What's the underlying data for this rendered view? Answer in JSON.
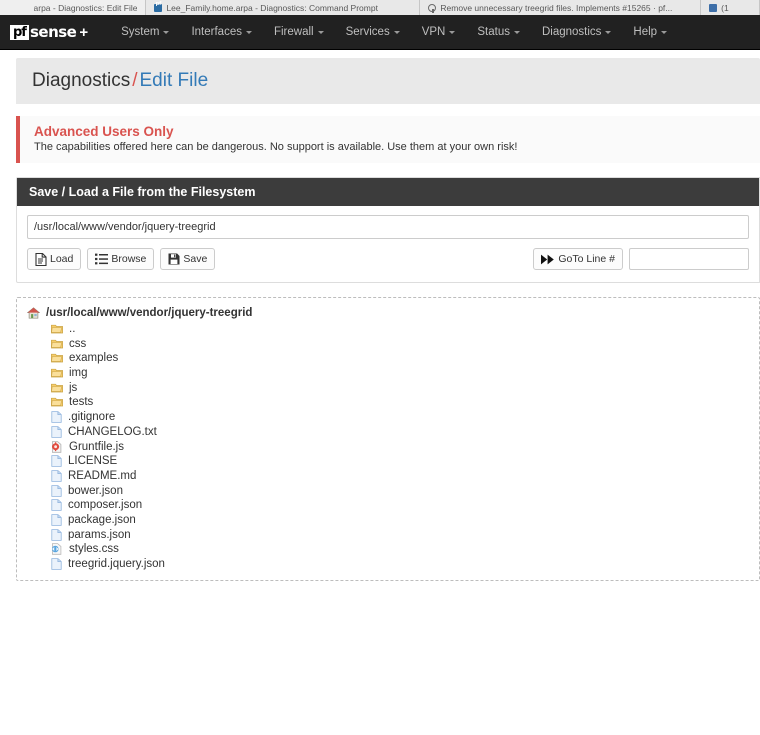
{
  "browser": {
    "tabs": [
      {
        "title": "arpa - Diagnostics: Edit File",
        "favicon": "pfsense-favicon",
        "truncated_left": true
      },
      {
        "title": "Lee_Family.home.arpa - Diagnostics: Command Prompt",
        "favicon": "pfsense-favicon"
      },
      {
        "title": "Remove unnecessary treegrid files. Implements #15265 · pf...",
        "favicon": "github-favicon"
      },
      {
        "title": "(1",
        "favicon": "chart-favicon"
      }
    ]
  },
  "navbar": {
    "brand": {
      "logo": "pf",
      "name": "sense",
      "suffix": "+"
    },
    "items": [
      {
        "label": "System",
        "caret": true
      },
      {
        "label": "Interfaces",
        "caret": true
      },
      {
        "label": "Firewall",
        "caret": true
      },
      {
        "label": "Services",
        "caret": true
      },
      {
        "label": "VPN",
        "caret": true
      },
      {
        "label": "Status",
        "caret": true
      },
      {
        "label": "Diagnostics",
        "caret": true
      },
      {
        "label": "Help",
        "caret": true
      }
    ]
  },
  "breadcrumb": {
    "section": "Diagnostics",
    "separator": "/",
    "page": "Edit File"
  },
  "alert": {
    "title": "Advanced Users Only",
    "body": "The capabilities offered here can be dangerous. No support is available. Use them at your own risk!"
  },
  "panel": {
    "heading": "Save / Load a File from the Filesystem",
    "path_value": "/usr/local/www/vendor/jquery-treegrid",
    "path_placeholder": "",
    "buttons": {
      "load": "Load",
      "browse": "Browse",
      "save": "Save",
      "goto_line": "GoTo Line #"
    },
    "line_value": "",
    "line_placeholder": ""
  },
  "filebrowser": {
    "root": {
      "name": "/usr/local/www/vendor/jquery-treegrid",
      "icon": "home-icon"
    },
    "entries": [
      {
        "name": "..",
        "icon": "folder-icon",
        "type": "folder"
      },
      {
        "name": "css",
        "icon": "folder-icon",
        "type": "folder"
      },
      {
        "name": "examples",
        "icon": "folder-icon",
        "type": "folder"
      },
      {
        "name": "img",
        "icon": "folder-icon",
        "type": "folder"
      },
      {
        "name": "js",
        "icon": "folder-icon",
        "type": "folder"
      },
      {
        "name": "tests",
        "icon": "folder-icon",
        "type": "folder"
      },
      {
        "name": ".gitignore",
        "icon": "file-icon",
        "type": "file"
      },
      {
        "name": "CHANGELOG.txt",
        "icon": "file-icon",
        "type": "file"
      },
      {
        "name": "Gruntfile.js",
        "icon": "script-file-icon",
        "type": "file"
      },
      {
        "name": "LICENSE",
        "icon": "file-icon",
        "type": "file"
      },
      {
        "name": "README.md",
        "icon": "file-icon",
        "type": "file"
      },
      {
        "name": "bower.json",
        "icon": "file-icon",
        "type": "file"
      },
      {
        "name": "composer.json",
        "icon": "file-icon",
        "type": "file"
      },
      {
        "name": "package.json",
        "icon": "file-icon",
        "type": "file"
      },
      {
        "name": "params.json",
        "icon": "file-icon",
        "type": "file"
      },
      {
        "name": "styles.css",
        "icon": "code-file-icon",
        "type": "file"
      },
      {
        "name": "treegrid.jquery.json",
        "icon": "file-icon",
        "type": "file"
      }
    ]
  },
  "colors": {
    "navbar_bg": "#212121",
    "panel_heading_bg": "#3c3c3c",
    "danger": "#d9534f",
    "link": "#337ab7",
    "folder": "#f5c451",
    "file": "#aecbee"
  }
}
